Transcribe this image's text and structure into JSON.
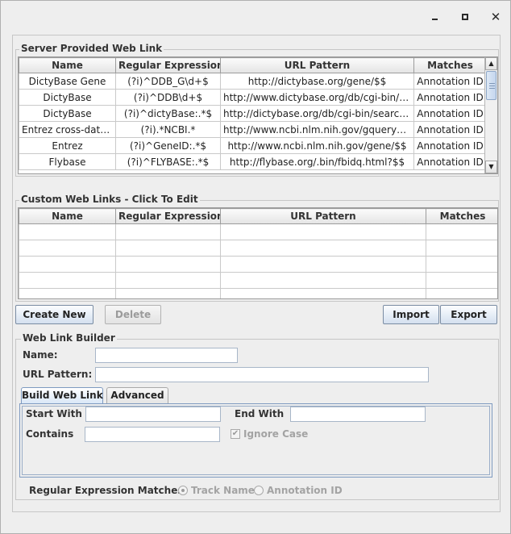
{
  "window": {
    "minimize_icon": "minimize-icon",
    "maximize_icon": "maximize-icon",
    "close_icon": "close-icon",
    "close_glyph": "✕"
  },
  "server_links": {
    "title": "Server Provided Web Link",
    "columns": [
      "Name",
      "Regular Expression",
      "URL Pattern",
      "Matches"
    ],
    "rows": [
      [
        "DictyBase Gene",
        "(?i)^DDB_G\\d+$",
        "http://dictybase.org/gene/$$",
        "Annotation ID"
      ],
      [
        "DictyBase",
        "(?i)^DDB\\d+$",
        "http://www.dictybase.org/db/cgi-bin/searc...",
        "Annotation ID"
      ],
      [
        "DictyBase",
        "(?i)^dictyBase:.*$",
        "http://dictybase.org/db/cgi-bin/search/sear...",
        "Annotation ID"
      ],
      [
        "Entrez cross-datab...",
        "(?i).*NCBI.*",
        "http://www.ncbi.nlm.nih.gov/gquery?term=...",
        "Annotation ID"
      ],
      [
        "Entrez",
        "(?i)^GeneID:.*$",
        "http://www.ncbi.nlm.nih.gov/gene/$$",
        "Annotation ID"
      ],
      [
        "Flybase",
        "(?i)^FLYBASE:.*$",
        "http://flybase.org/.bin/fbidq.html?$$",
        "Annotation ID"
      ]
    ]
  },
  "custom_links": {
    "title": "Custom Web Links - Click To Edit",
    "columns": [
      "Name",
      "Regular Expression",
      "URL Pattern",
      "Matches"
    ],
    "rows": [
      [
        "",
        "",
        "",
        ""
      ],
      [
        "",
        "",
        "",
        ""
      ],
      [
        "",
        "",
        "",
        ""
      ],
      [
        "",
        "",
        "",
        ""
      ],
      [
        "",
        "",
        "",
        ""
      ]
    ]
  },
  "buttons": {
    "create_new": "Create New",
    "delete": "Delete",
    "import": "Import",
    "export": "Export"
  },
  "builder": {
    "title": "Web Link Builder",
    "name_label": "Name:",
    "name_value": "",
    "url_label": "URL Pattern:",
    "url_value": "",
    "tabs": [
      "Build Web Link",
      "Advanced"
    ],
    "start_with_label": "Start With",
    "start_with_value": "",
    "end_with_label": "End With",
    "end_with_value": "",
    "contains_label": "Contains",
    "contains_value": "",
    "ignore_case_label": "Ignore Case",
    "ignore_case_checked": true,
    "regex_matches_label": "Regular Expression Matches:",
    "track_name_label": "Track Name",
    "annotation_id_label": "Annotation ID",
    "selected_match": "Track Name"
  }
}
